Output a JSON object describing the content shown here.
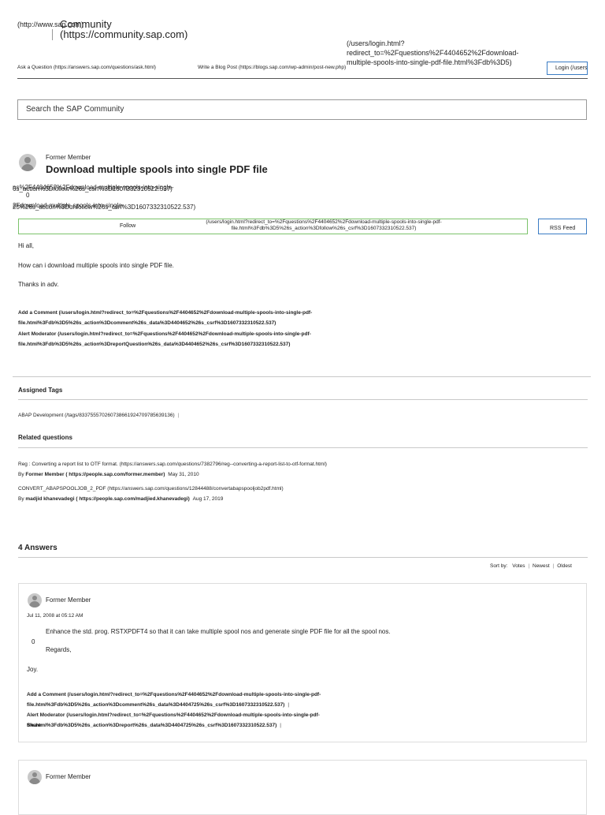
{
  "header": {
    "home_url_text": "(http://www.sap.com)",
    "community_title": "Community",
    "community_url_text": "(https://community.sap.com)",
    "login_redirect_text": "(/users/login.html?\nredirect_to=%2Fquestions%2F4404652%2Fdownload-\nmultiple-spools-into-single-pdf-file.html%3Fdb%3D5)",
    "ask_question_text": "Ask a Question (https://answers.sap.com/questions/ask.html)",
    "write_blog_text": "Write a Blog Post (https://blogs.sap.com/wp-admin/post-new.php)",
    "login_button_label": "Login",
    "login_button_suffix": "(/users"
  },
  "search": {
    "placeholder": "Search the SAP Community"
  },
  "question": {
    "author": "Former Member",
    "title": "Download multiple spools into single PDF file",
    "meta_line1": "ns%2F4404652%2Fdownload-multiple-spools-into-single-",
    "meta_line1_overlay": "6s_action%3Dfollow%26s_csrf%3D1607332310522.537)",
    "meta_line2": "2Fdownload-multiple-spools-into-single-",
    "meta_line2_overlay": "25%26s_action%3Dunfollow%26s_csrf%3D1607332310522.537)",
    "meta_zero": "0",
    "follow_label": "Follow",
    "follow_url_text": "(/users/login.html?redirect_to=%2Fquestions%2F4404652%2Fdownload-multiple-spools-into-single-pdf-\nfile.html%3Fdb%3D5%26s_action%3Dfollow%26s_csrf%3D1607332310522.537)",
    "rss_label": "RSS Feed",
    "body": [
      "Hi all,",
      "How can i download multiple spools into single PDF file.",
      "Thanks in adv."
    ],
    "add_comment_text": "Add a Comment (/users/login.html?redirect_to=%2Fquestions%2F4404652%2Fdownload-multiple-spools-into-single-pdf-\nfile.html%3Fdb%3D5%26s_action%3Dcomment%26s_data%3D4404652%26s_csrf%3D1607332310522.537)",
    "alert_moderator_text": "Alert Moderator (/users/login.html?redirect_to=%2Fquestions%2F4404652%2Fdownload-multiple-spools-into-single-pdf-\nfile.html%3Fdb%3D5%26s_action%3DreportQuestion%26s_data%3D4404652%26s_csrf%3D1607332310522.537)"
  },
  "tags": {
    "heading": "Assigned Tags",
    "items": [
      "ABAP Development (/tags/833755570260738661924709785639136)"
    ]
  },
  "related": {
    "heading": "Related questions",
    "items": [
      {
        "title": "Reg : Converting a report list to OTF format. (https://answers.sap.com/questions/7382796/reg--converting-a-report-list-to-otf-format.html)",
        "by": "By",
        "author": "Former Member ( https://people.sap.com/former.member)",
        "date": "May 31, 2010"
      },
      {
        "title": "CONVERT_ABAPSPOOLJOB_2_PDF (https://answers.sap.com/questions/12844488/convertabapspooljob2pdf.html)",
        "by": "By",
        "author": "madjid khanevadegi ( https://people.sap.com/madjied.khanevadegi)",
        "date": "Aug 17, 2019"
      }
    ]
  },
  "answers": {
    "heading": "4 Answers",
    "sort_label": "Sort by:",
    "sort_options": [
      "Votes",
      "Newest",
      "Oldest"
    ],
    "items": [
      {
        "author": "Former Member",
        "date": "Jul 11, 2008 at 05:12 AM",
        "body": "Enhance the std. prog. RSTXPDFT4 so that it can take multiple spool nos and generate single PDF file for all the spool nos.",
        "overlay1": "0",
        "regards": "Regards,",
        "signature": "Joy.",
        "add_comment_text": "Add a Comment (/users/login.html?redirect_to=%2Fquestions%2F4404652%2Fdownload-multiple-spools-into-single-pdf-\nfile.html%3Fdb%3D5%26s_action%3Dcomment%26s_data%3D4404725%26s_csrf%3D1607332310522.537)",
        "alert_moderator_text": "Alert Moderator (/users/login.html?redirect_to=%2Fquestions%2F4404652%2Fdownload-multiple-spools-into-single-pdf-\nfile.html%3Fdb%3D5%26s_action%3Dreport%26s_data%3D4404725%26s_csrf%3D1607332310522.537)",
        "share_label": "Share"
      },
      {
        "author": "Former Member"
      }
    ]
  },
  "colors": {
    "follow_border": "#7cc36b",
    "rss_border": "#3a7cc4",
    "login_border": "#3a7cc4"
  }
}
